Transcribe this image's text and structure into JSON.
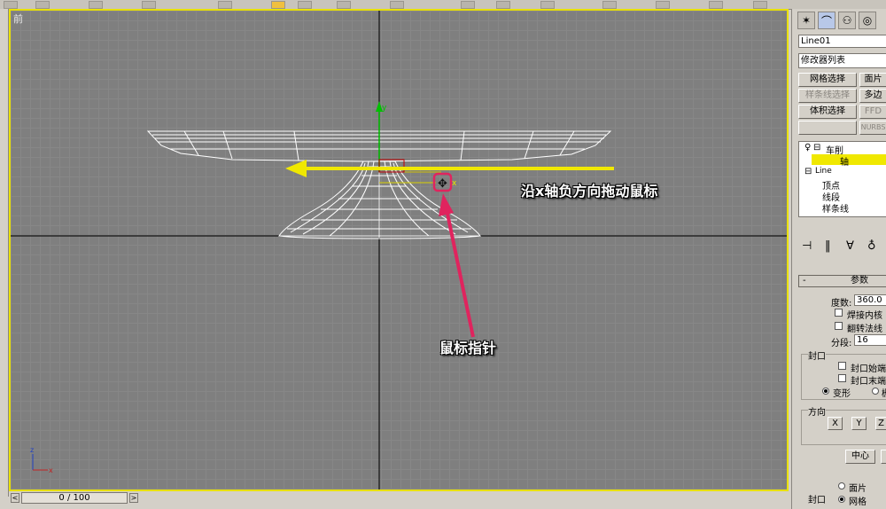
{
  "viewport": {
    "label": "前",
    "annotation_drag": "沿x轴负方向拖动鼠标",
    "annotation_pointer": "鼠标指针",
    "highlight_color": "#e8e000",
    "annotation_color": "#e0245e",
    "arrow_color": "#f0e800"
  },
  "timeline": {
    "slider_text": "0 / 100",
    "prev": "<",
    "next": ">"
  },
  "panel": {
    "tabs": [
      "create-icon",
      "modify-icon",
      "hierarchy-icon",
      "motion-icon"
    ],
    "object_name": "Line01",
    "modifier_list": "修改器列表",
    "buttons": {
      "mesh_select": "网格选择",
      "face": "面片",
      "spline_select": "样条线选择",
      "poly": "多边",
      "volume_select": "体积选择",
      "ffd": "FFD",
      "nurbs": "NURBS"
    },
    "stack": {
      "lathe": "车削",
      "axis": "轴",
      "line": "Line",
      "vertex": "顶点",
      "segment": "线段",
      "spline": "样条线"
    },
    "params": {
      "header": "参数",
      "collapse": "-",
      "degrees_label": "度数:",
      "degrees_value": "360.0",
      "weld_core": "焊接内核",
      "flip_normals": "翻转法线",
      "segments_label": "分段:",
      "segments_value": "16",
      "cap_group": "封口",
      "cap_start": "封口始端",
      "cap_end": "封口末端",
      "morph": "变形",
      "grid_partial": "栅",
      "direction_group": "方向",
      "dir_x": "X",
      "dir_y": "Y",
      "dir_z": "Z",
      "align_center": "中心",
      "output_group": "封口",
      "out_patch": "面片",
      "out_mesh": "网格"
    }
  }
}
